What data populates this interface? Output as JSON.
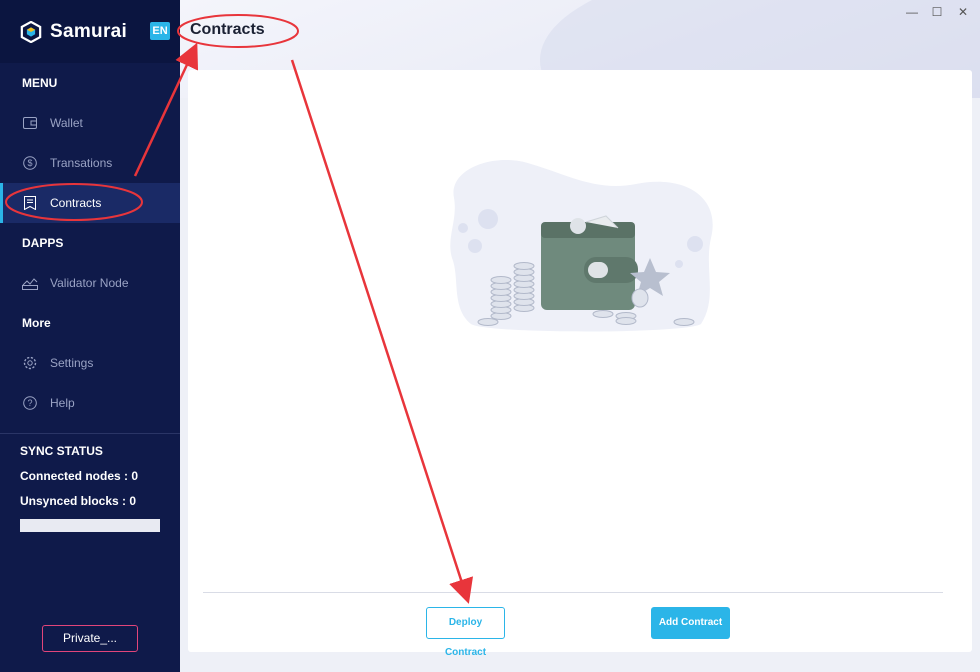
{
  "app": {
    "name": "Samurai",
    "lang": "EN"
  },
  "sidebar": {
    "menu_title": "MENU",
    "items": [
      {
        "label": "Wallet",
        "icon": "wallet-icon"
      },
      {
        "label": "Transations",
        "icon": "dollar-circle-icon"
      },
      {
        "label": "Contracts",
        "icon": "contract-icon",
        "active": true
      }
    ],
    "dapps_title": "DAPPS",
    "dapps_items": [
      {
        "label": "Validator Node",
        "icon": "validator-icon"
      }
    ],
    "more_title": "More",
    "more_items": [
      {
        "label": "Settings",
        "icon": "gear-icon"
      },
      {
        "label": "Help",
        "icon": "help-icon"
      }
    ]
  },
  "sync": {
    "title": "SYNC STATUS",
    "connected_nodes": "Connected nodes : 0",
    "unsynced_blocks": "Unsynced blocks : 0"
  },
  "network_button": "Private_...",
  "header": {
    "title": "Contracts"
  },
  "window_controls": {
    "minimize": "—",
    "maximize": "☐",
    "close": "✕"
  },
  "actions": {
    "deploy": "Deploy Contract",
    "add": "Add Contract"
  },
  "colors": {
    "accent": "#2bb5e8",
    "sidebar": "#0f1a4a",
    "annotation": "#e8353b",
    "network_border": "#e2457a"
  }
}
